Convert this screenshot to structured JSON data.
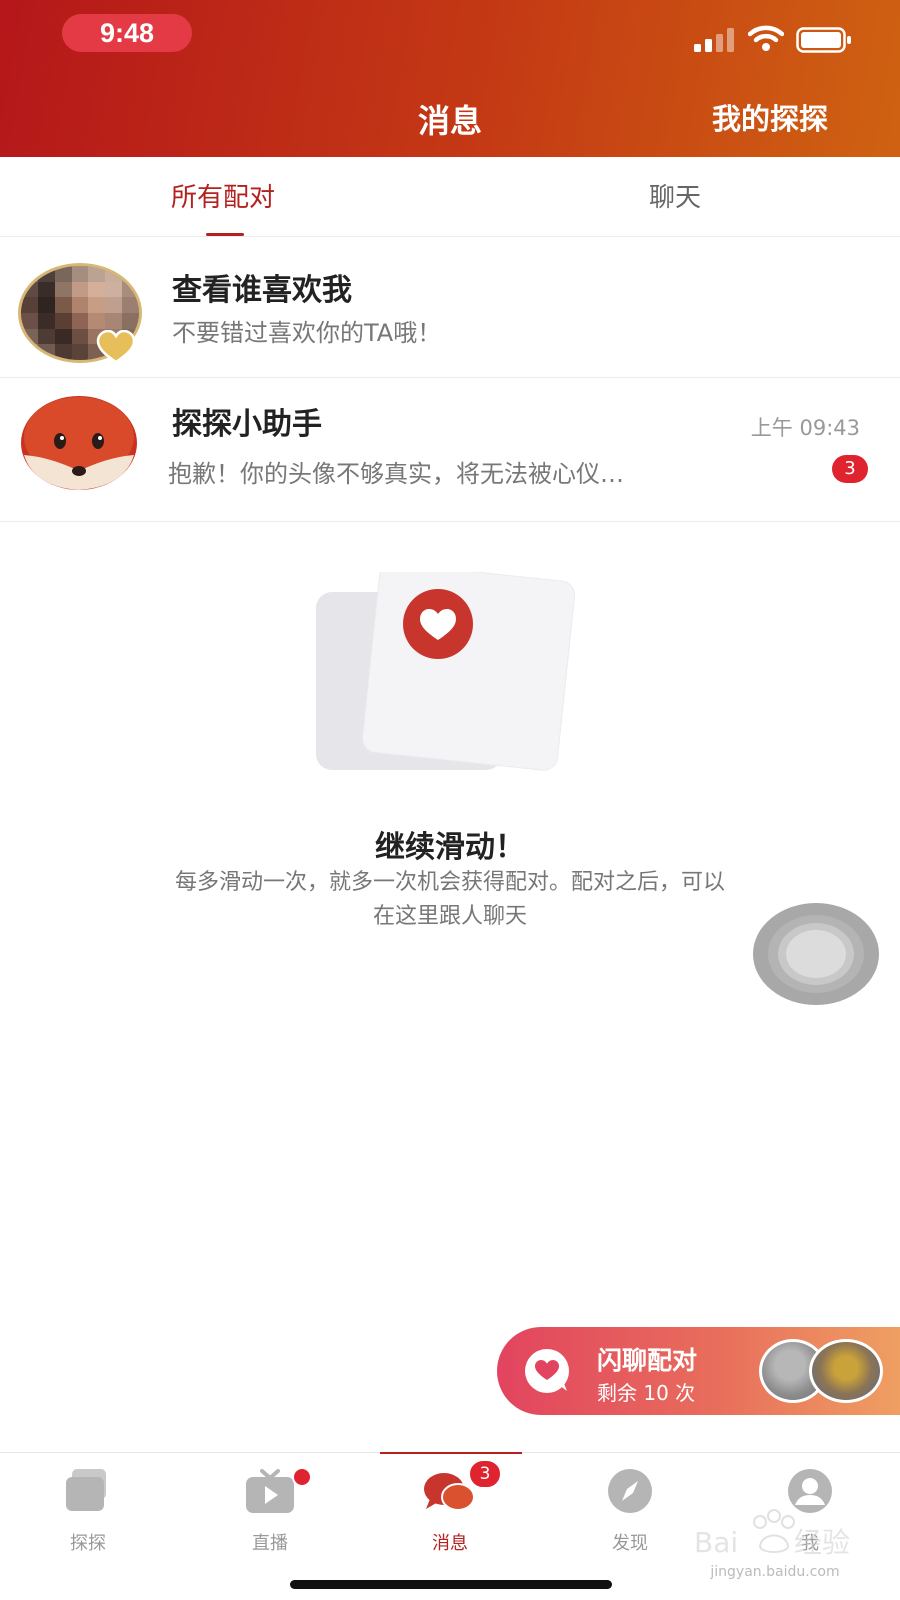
{
  "status_bar": {
    "time": "9:48"
  },
  "header": {
    "title": "消息",
    "right_label": "我的探探"
  },
  "tabs": [
    {
      "label": "所有配对",
      "active": true
    },
    {
      "label": "聊天",
      "active": false
    }
  ],
  "list": [
    {
      "title": "查看谁喜欢我",
      "subtitle": "不要错过喜欢你的TA哦！",
      "avatar": "blurred-user-avatar",
      "badge_icon": "gold-heart-icon"
    },
    {
      "title": "探探小助手",
      "subtitle": "抱歉！你的头像不够真实，将无法被心仪…",
      "time": "上午 09:43",
      "unread": "3",
      "avatar": "fox-mascot-icon"
    }
  ],
  "empty_state": {
    "title": "继续滑动！",
    "description_line1": "每多滑动一次，就多一次机会获得配对。配对之后，可以",
    "description_line2": "在这里跟人聊天"
  },
  "flash_match": {
    "title": "闪聊配对",
    "subtitle": "剩余 10 次"
  },
  "bottom_nav": [
    {
      "label": "探探",
      "icon": "cards-icon",
      "active": false
    },
    {
      "label": "直播",
      "icon": "tv-icon",
      "active": false,
      "dot": true
    },
    {
      "label": "消息",
      "icon": "chat-bubbles-icon",
      "active": true,
      "count": "3"
    },
    {
      "label": "发现",
      "icon": "compass-icon",
      "active": false
    },
    {
      "label": "我",
      "icon": "profile-icon",
      "active": false
    }
  ],
  "watermark": {
    "url": "jingyan.baidu.com"
  },
  "colors": {
    "brand_red": "#b3221f",
    "header_start": "#b5171a",
    "header_end": "#cf6212",
    "badge_red": "#e0242f"
  }
}
